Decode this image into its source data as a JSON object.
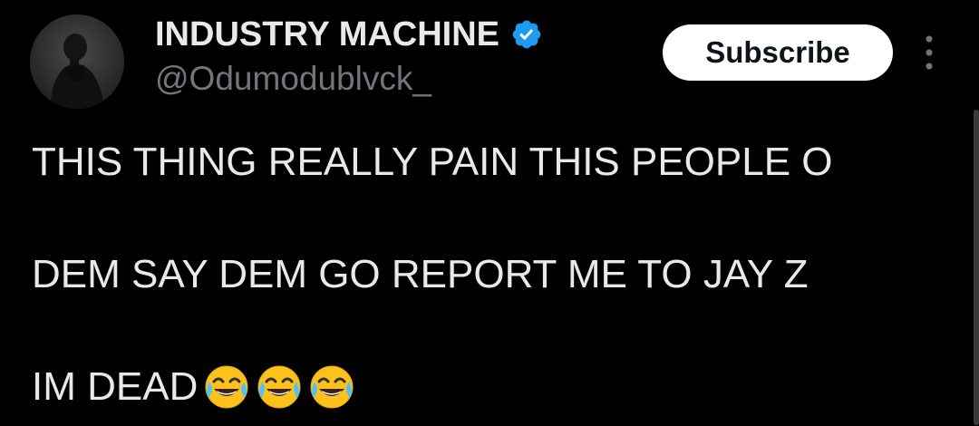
{
  "author": {
    "display_name": "INDUSTRY MACHINE",
    "handle": "@Odumodublvck_",
    "verified": true,
    "verified_icon": "verified-badge-icon",
    "avatar": "profile-photo"
  },
  "actions": {
    "subscribe_label": "Subscribe",
    "more_icon": "more-vertical-icon"
  },
  "tweet": {
    "line1": "THIS THING REALLY PAIN THIS PEOPLE O",
    "line2": "DEM SAY DEM GO REPORT ME TO JAY Z",
    "line3": "IM DEAD",
    "emojis": [
      "face-with-tears-of-joy",
      "face-with-tears-of-joy",
      "face-with-tears-of-joy"
    ]
  },
  "colors": {
    "background": "#000000",
    "text": "#e7e9ea",
    "muted": "#71767b",
    "verified": "#1d9bf0",
    "button_bg": "#ffffff",
    "button_text": "#0f1419"
  }
}
